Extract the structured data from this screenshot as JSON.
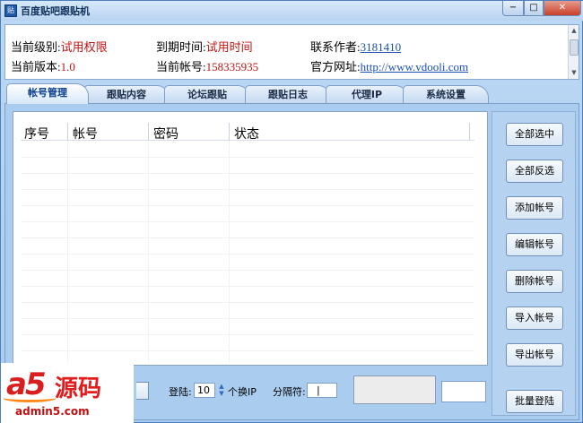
{
  "window": {
    "title": "百度贴吧跟贴机",
    "icon_label": "贴",
    "controls": {
      "minimize": "−",
      "maximize": "□",
      "close": "✕"
    }
  },
  "info": {
    "level_label": "当前级别:",
    "level_value": "试用权限",
    "version_label": "当前版本:",
    "version_value": "1.0",
    "expire_label": "到期时间:",
    "expire_value": "试用时间",
    "account_label": "当前帐号:",
    "account_value": "158335935",
    "contact_label": "联系作者:",
    "contact_value": "3181410",
    "website_label": "官方网址:",
    "website_value": "http://www.vdooli.com"
  },
  "tabs": [
    {
      "label": "帐号管理",
      "active": true
    },
    {
      "label": "跟贴内容",
      "active": false
    },
    {
      "label": "论坛跟贴",
      "active": false
    },
    {
      "label": "跟贴日志",
      "active": false
    },
    {
      "label": "代理IP",
      "active": false
    },
    {
      "label": "系统设置",
      "active": false
    }
  ],
  "table": {
    "columns": [
      "序号",
      "帐号",
      "密码",
      "状态"
    ],
    "rows": []
  },
  "side_buttons": [
    "全部选中",
    "全部反选",
    "添加帐号",
    "编辑帐号",
    "删除帐号",
    "导入帐号",
    "导出帐号",
    "批量登陆"
  ],
  "bottom": {
    "login_label": "登陆:",
    "login_count": "10",
    "switch_ip_label": "个换IP",
    "separator_label": "分隔符:",
    "separator_value": "|"
  },
  "watermark": {
    "logo": "a5",
    "logo_cn": "源码",
    "url": "admin5.com"
  }
}
